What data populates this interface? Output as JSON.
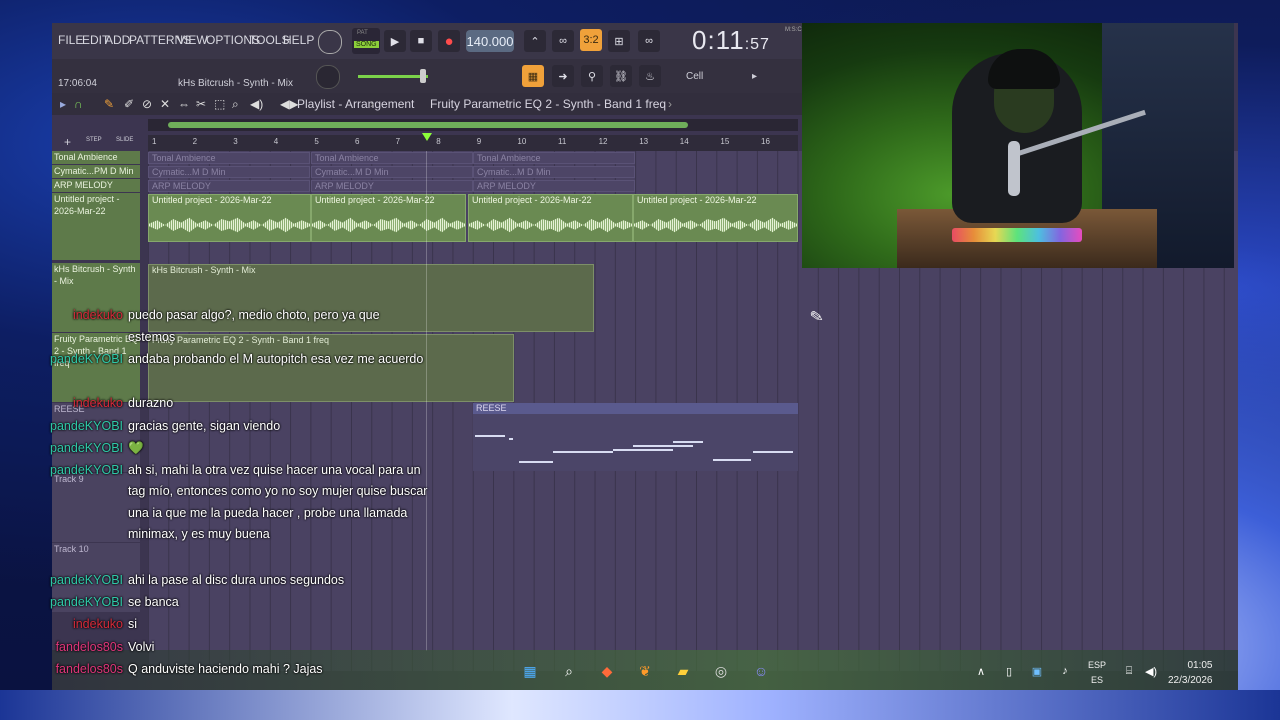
{
  "menu": [
    "FILE",
    "EDIT",
    "ADD",
    "PATTERNS",
    "VIEW",
    "OPTIONS",
    "TOOLS",
    "HELP"
  ],
  "transport": {
    "pat": "PAT",
    "song": "SONG",
    "tempo": "140.000",
    "time_main": "0:11",
    "time_small": ":57",
    "time_unit": "M:S:CS"
  },
  "toolbar": {
    "step_label": "3:2",
    "cell_label": "Cell"
  },
  "hint": {
    "time": "17:06:04",
    "text": "kHs Bitcrush - Synth - Mix"
  },
  "playlist": {
    "title": "Playlist - Arrangement",
    "selected": "Fruity Parametric EQ 2 - Synth - Band 1 freq",
    "step_label": "STEP",
    "slide_label": "SLIDE"
  },
  "ruler": [
    "1",
    "2",
    "3",
    "4",
    "5",
    "6",
    "7",
    "8",
    "9",
    "10",
    "11",
    "12",
    "13",
    "14",
    "15",
    "16"
  ],
  "tracks": [
    {
      "label": "Tonal Ambience",
      "style": "green"
    },
    {
      "label": "Cymatic...PM D Min",
      "style": "green"
    },
    {
      "label": "ARP MELODY",
      "style": "green"
    },
    {
      "label": "Untitled project - 2026-Mar-22",
      "style": "green"
    },
    {
      "label": "kHs Bitcrush - Synth - Mix",
      "style": "green"
    },
    {
      "label": "Fruity Parametric EQ 2 - Synth - Band 1 freq",
      "style": "green"
    },
    {
      "label": "REESE",
      "style": "dark"
    },
    {
      "label": "Track 9",
      "style": "dark"
    },
    {
      "label": "Track 10",
      "style": "dark"
    }
  ],
  "clips": {
    "ghost_tonal": "Tonal Ambience",
    "ghost_cymatic": "Cymatic...M D Min",
    "ghost_arp": "ARP MELODY",
    "audio": "Untitled project - 2026-Mar-22",
    "auto_bitcrush": "kHs Bitcrush - Synth - Mix",
    "auto_eq": "Fruity Parametric EQ 2 - Synth - Band 1 freq",
    "pattern_reese": "REESE"
  },
  "chat": [
    {
      "user": "indekuko",
      "color": "#d42a3a",
      "text": "puedo pasar algo?, medio choto, pero ya que estemos"
    },
    {
      "user": "pandeKYOBI",
      "color": "#2fc9a8",
      "text": "andaba probando el M autopitch esa vez me acuerdo"
    },
    {
      "user": "indekuko",
      "color": "#d42a3a",
      "text": "durazno"
    },
    {
      "user": "pandeKYOBI",
      "color": "#2fc9a8",
      "text": "gracias gente, sigan viendo"
    },
    {
      "user": "pandeKYOBI",
      "color": "#2fc9a8",
      "text": "💚"
    },
    {
      "user": "pandeKYOBI",
      "color": "#2fc9a8",
      "text": "ah si, mahi la otra vez quise hacer una vocal para un tag mío, entonces como yo no soy mujer quise buscar una ia que me la pueda hacer , probe una llamada minimax, y es muy buena"
    },
    {
      "user": "pandeKYOBI",
      "color": "#2fc9a8",
      "text": "ahi la pase al disc dura unos segundos"
    },
    {
      "user": "pandeKYOBI",
      "color": "#2fc9a8",
      "text": "se banca"
    },
    {
      "user": "indekuko",
      "color": "#d42a3a",
      "text": "si"
    },
    {
      "user": "fandelos80s",
      "color": "#e0357a",
      "text": "Volvi"
    },
    {
      "user": "fandelos80s",
      "color": "#e0357a",
      "text": "Q anduviste haciendo mahi ? Jajas"
    }
  ],
  "taskbar": {
    "lang1": "ESP",
    "lang2": "ES",
    "time": "01:05",
    "date": "22/3/2026"
  }
}
